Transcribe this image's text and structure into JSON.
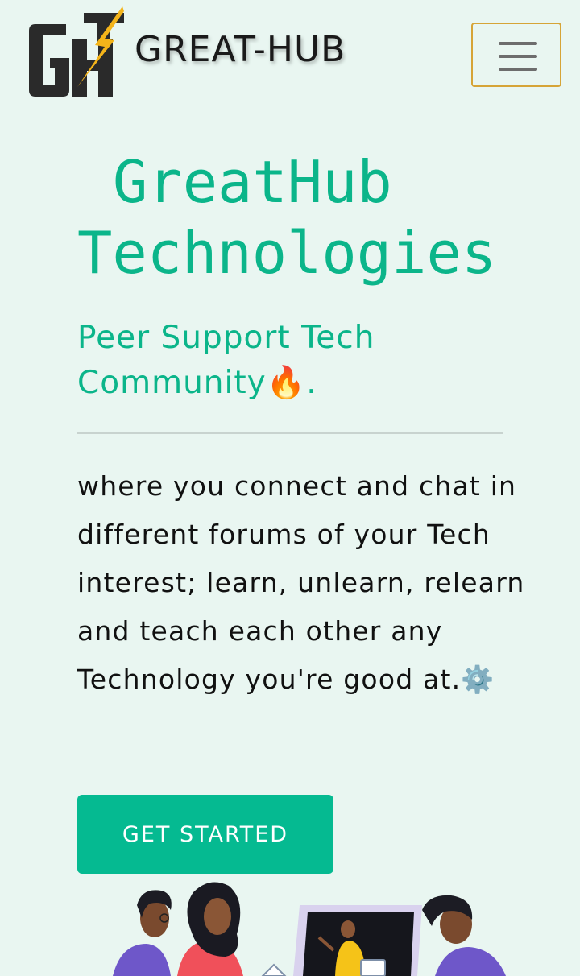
{
  "header": {
    "brand": "GREAT-HUB",
    "logo_text": "GH",
    "menu_icon": "hamburger-menu-icon"
  },
  "hero": {
    "title_line1": "GreatHub",
    "title_line2": "Technologies",
    "tagline": "Peer Support Tech Community🔥.",
    "description": "where you connect and chat in different forums of your Tech interest; learn, unlearn, relearn and teach each other any Technology you're good at.⚙️",
    "cta_label": "GET STARTED"
  },
  "colors": {
    "background": "#e9f6f1",
    "accent": "#0bb58a",
    "button": "#05ba91",
    "menu_border": "#d6a437"
  }
}
